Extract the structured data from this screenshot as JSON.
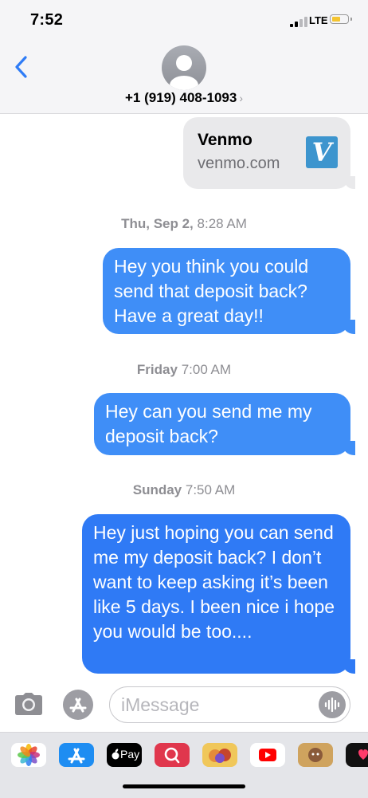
{
  "status": {
    "time": "7:52",
    "network": "LTE"
  },
  "header": {
    "contact": "+1 (919) 408-1093"
  },
  "link_preview": {
    "title": "Venmo",
    "url": "venmo.com",
    "logo_letter": "V"
  },
  "messages": [
    {
      "timestamp_day": "Thu, Sep 2,",
      "timestamp_time": "8:28 AM",
      "text": "Hey you think you could send that deposit back? Have a great day!!"
    },
    {
      "timestamp_day": "Friday",
      "timestamp_time": "7:00 AM",
      "text": "Hey can you send me my deposit back?"
    },
    {
      "timestamp_day": "Sunday",
      "timestamp_time": "7:50 AM",
      "text": "Hey just hoping you can send me my deposit back? I don’t want to keep asking it’s been like 5 days. I been nice i hope you would be too...."
    }
  ],
  "composer": {
    "placeholder": "iMessage"
  },
  "app_drawer": {
    "apps": [
      {
        "icon": "photos-icon"
      },
      {
        "icon": "app-store-icon"
      },
      {
        "icon": "apple-pay-icon",
        "label": "Pay"
      },
      {
        "icon": "search-images-icon"
      },
      {
        "icon": "memoji-stickers-icon"
      },
      {
        "icon": "youtube-icon"
      },
      {
        "icon": "memoji-icon"
      },
      {
        "icon": "digital-touch-icon"
      }
    ]
  },
  "colors": {
    "outgoing_bubble": "#3f8ef7",
    "incoming_bubble": "#e9e9eb",
    "venmo": "#3d95ce"
  }
}
